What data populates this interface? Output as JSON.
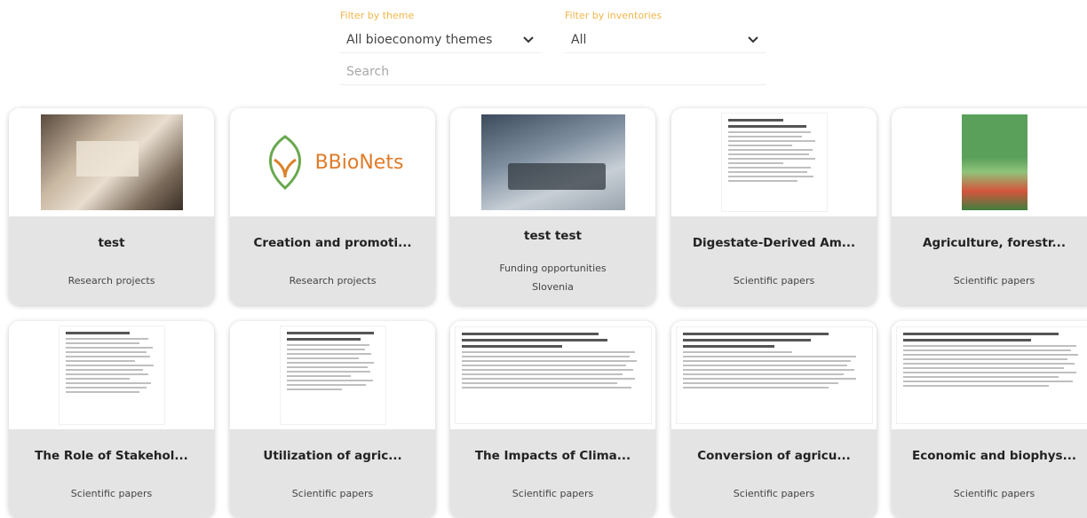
{
  "filters": {
    "theme": {
      "label": "Filter by theme",
      "value": "All bioeconomy themes"
    },
    "inventory": {
      "label": "Filter by inventories",
      "value": "All"
    },
    "search": {
      "placeholder": "Search"
    }
  },
  "colors": {
    "accent": "#f0b64a",
    "card_info_bg": "#e4e4e4"
  },
  "cards": [
    {
      "title": "test",
      "category": "Research projects",
      "thumbnail": "map-photo"
    },
    {
      "title": "Creation and promoti...",
      "category": "Research projects",
      "thumbnail": "bbionets-logo",
      "logo_text": "BBioNets"
    },
    {
      "title": "test test",
      "category": "Funding opportunities",
      "extra": "Slovenia",
      "thumbnail": "laptop-photo"
    },
    {
      "title": "Digestate-Derived Am...",
      "category": "Scientific papers",
      "thumbnail": "paper-page"
    },
    {
      "title": "Agriculture, forestr...",
      "category": "Scientific papers",
      "thumbnail": "report-cover"
    },
    {
      "title": "The Role of Stakehol...",
      "category": "Scientific papers",
      "thumbnail": "paper-page"
    },
    {
      "title": "Utilization of agric...",
      "category": "Scientific papers",
      "thumbnail": "paper-page"
    },
    {
      "title": "The Impacts of Clima...",
      "category": "Scientific papers",
      "thumbnail": "paper-page"
    },
    {
      "title": "Conversion of agricu...",
      "category": "Scientific papers",
      "thumbnail": "paper-page"
    },
    {
      "title": "Economic and biophys...",
      "category": "Scientific papers",
      "thumbnail": "paper-page"
    }
  ]
}
